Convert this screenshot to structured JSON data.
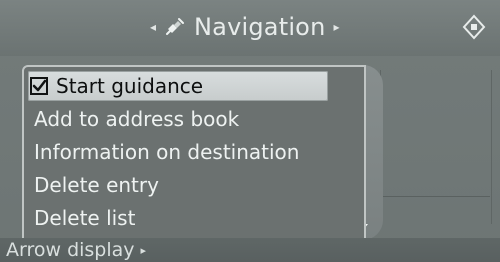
{
  "header": {
    "title": "Navigation",
    "left_arrow": "◂",
    "right_arrow": "▸",
    "nav_icon": "satellite-icon",
    "corner_icon": "diamond-menu-icon"
  },
  "menu": {
    "items": [
      {
        "label": "Start guidance",
        "selected": true,
        "check_icon": "check-icon"
      },
      {
        "label": "Add to address book"
      },
      {
        "label": "Information on destination"
      },
      {
        "label": "Delete entry"
      },
      {
        "label": "Delete list"
      }
    ]
  },
  "footer": {
    "label": "Arrow display",
    "arrow": "▸"
  }
}
